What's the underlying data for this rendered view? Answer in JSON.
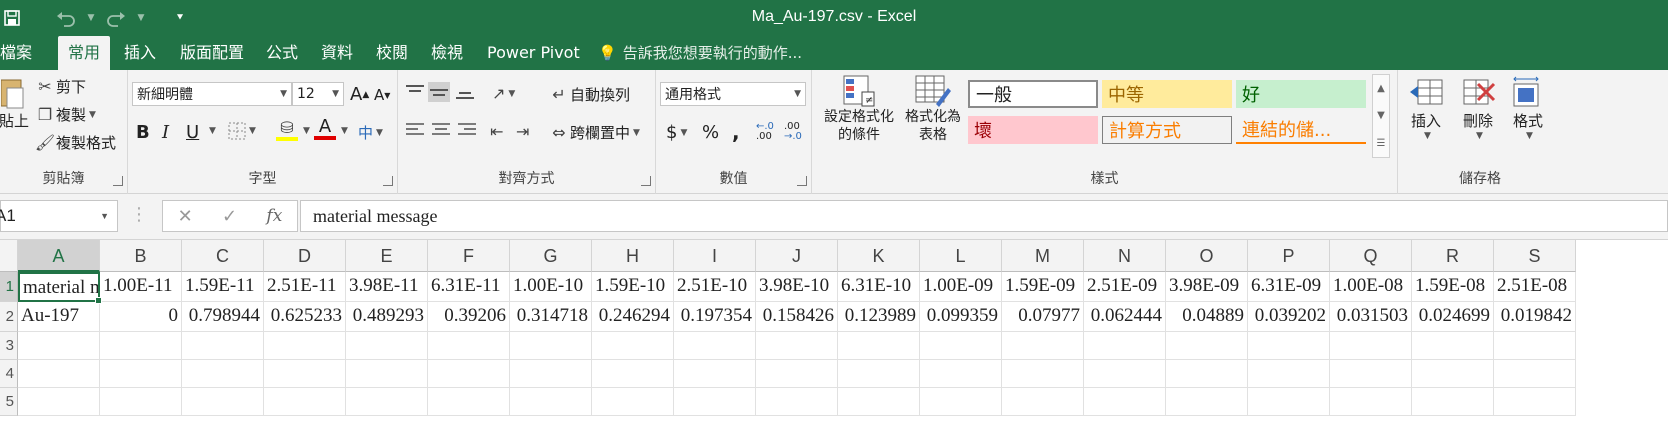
{
  "window": {
    "title": "Ma_Au-197.csv - Excel"
  },
  "qat": {
    "icons": [
      "save-icon",
      "undo-icon",
      "redo-icon",
      "customize-icon"
    ]
  },
  "tabs": [
    "檔案",
    "常用",
    "插入",
    "版面配置",
    "公式",
    "資料",
    "校閱",
    "檢視",
    "Power Pivot"
  ],
  "active_tab": "常用",
  "tell_me": "告訴我您想要執行的動作...",
  "ribbon": {
    "clipboard": {
      "paste": "貼上",
      "cut": "剪下",
      "copy": "複製",
      "format_painter": "複製格式",
      "label": "剪貼簿"
    },
    "font": {
      "name": "新細明體",
      "size": "12",
      "bold": "B",
      "italic": "I",
      "underline": "U",
      "label": "字型"
    },
    "alignment": {
      "wrap": "自動換列",
      "merge": "跨欄置中",
      "label": "對齊方式"
    },
    "number": {
      "format": "通用格式",
      "currency": "$",
      "percent": "%",
      "comma": ",",
      "inc_decimal": ".00",
      "dec_decimal": ".00",
      "label": "數值"
    },
    "styles": {
      "conditional": "設定格式化的條件",
      "table": "格式化為表格",
      "cells": [
        "一般",
        "中等",
        "好",
        "壞",
        "計算方式",
        "連結的儲..."
      ],
      "label": "樣式",
      "colors": {
        "normal": "#ffffff",
        "neutral": "#ffeb9c",
        "good": "#c6efce",
        "bad": "#ffc7ce",
        "calc": "#f2f2f2"
      }
    },
    "cells_group": {
      "insert": "插入",
      "delete": "刪除",
      "format": "格式",
      "label": "儲存格"
    }
  },
  "formula_bar": {
    "name_box": "A1",
    "fx": "fx",
    "formula": "material message"
  },
  "sheet": {
    "columns": [
      "A",
      "B",
      "C",
      "D",
      "E",
      "F",
      "G",
      "H",
      "I",
      "J",
      "K",
      "L",
      "M",
      "N",
      "O",
      "P",
      "Q",
      "R",
      "S"
    ],
    "row_numbers": [
      "1",
      "2",
      "3",
      "4",
      "5"
    ],
    "rows": [
      [
        "material message",
        "1.00E-11",
        "1.59E-11",
        "2.51E-11",
        "3.98E-11",
        "6.31E-11",
        "1.00E-10",
        "1.59E-10",
        "2.51E-10",
        "3.98E-10",
        "6.31E-10",
        "1.00E-09",
        "1.59E-09",
        "2.51E-09",
        "3.98E-09",
        "6.31E-09",
        "1.00E-08",
        "1.59E-08",
        "2.51E-08"
      ],
      [
        "Au-197",
        "0",
        "0.798944",
        "0.625233",
        "0.489293",
        "0.39206",
        "0.314718",
        "0.246294",
        "0.197354",
        "0.158426",
        "0.123989",
        "0.099359",
        "0.07977",
        "0.062444",
        "0.04889",
        "0.039202",
        "0.031503",
        "0.024699",
        "0.019842"
      ]
    ],
    "accent": "#217346"
  }
}
